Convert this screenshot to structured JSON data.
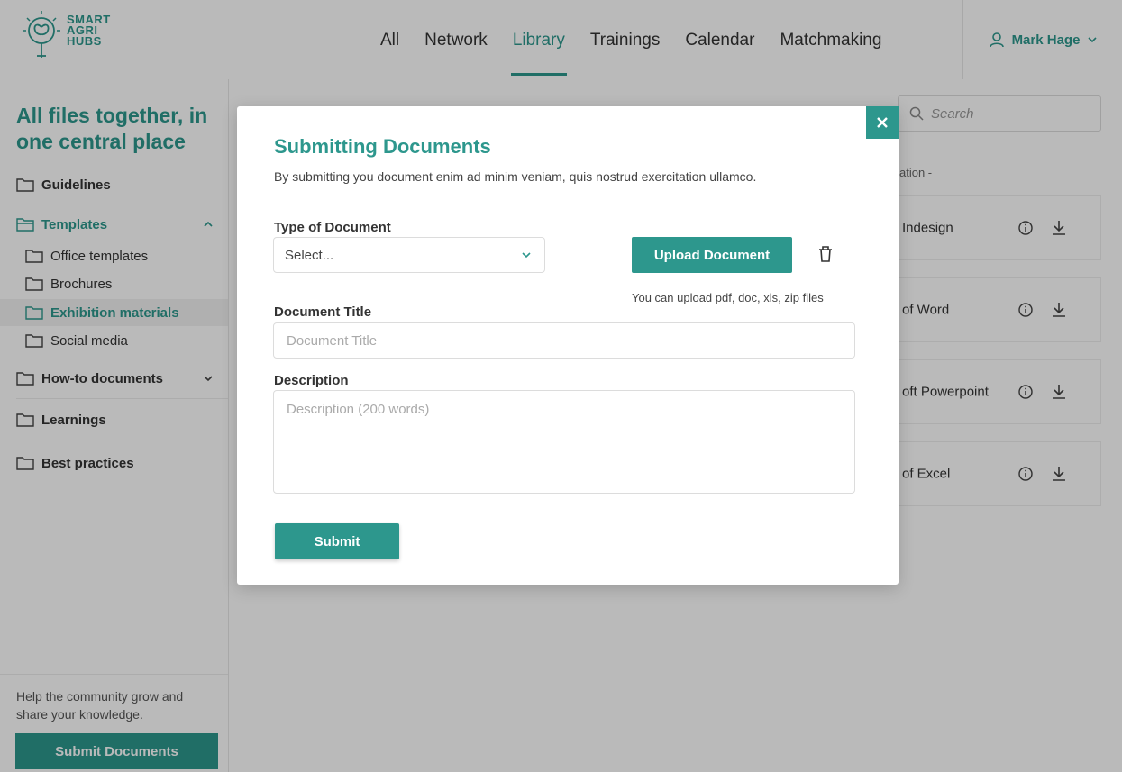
{
  "brand": {
    "logo_lines": [
      "SMART",
      "AGRI",
      "HUBS"
    ],
    "accent": "#2d978d"
  },
  "nav": {
    "items": [
      {
        "label": "All"
      },
      {
        "label": "Network"
      },
      {
        "label": "Library",
        "active": true
      },
      {
        "label": "Trainings"
      },
      {
        "label": "Calendar"
      },
      {
        "label": "Matchmaking"
      }
    ]
  },
  "user": {
    "name": "Mark Hage",
    "icon": "user-icon"
  },
  "sidebar": {
    "title": "All files together, in one central place",
    "items": [
      {
        "label": "Guidelines"
      },
      {
        "label": "Templates",
        "expanded": true
      },
      {
        "label": "Office templates"
      },
      {
        "label": "Brochures"
      },
      {
        "label": "Exhibition materials",
        "selected": true
      },
      {
        "label": "Social media"
      },
      {
        "label": "How-to documents"
      },
      {
        "label": "Learnings"
      },
      {
        "label": "Best practices"
      }
    ],
    "help_text": "Help the community grow and share your knowledge.",
    "submit_label": "Submit Documents"
  },
  "main": {
    "search_placeholder": "Search",
    "column_header": "ation -",
    "files": [
      {
        "name": "Indesign"
      },
      {
        "name": "of Word"
      },
      {
        "name": "oft Powerpoint"
      },
      {
        "name": "of Excel"
      }
    ]
  },
  "modal": {
    "title": "Submitting Documents",
    "subtitle": "By submitting you document enim ad minim veniam, quis nostrud exercitation ullamco.",
    "type_label": "Type of Document",
    "type_value": "Select...",
    "upload_label": "Upload Document",
    "upload_hint": "You can upload pdf, doc, xls, zip files",
    "title_label": "Document Title",
    "title_placeholder": "Document Title",
    "description_label": "Description",
    "description_placeholder": "Description (200 words)",
    "submit_label": "Submit"
  }
}
